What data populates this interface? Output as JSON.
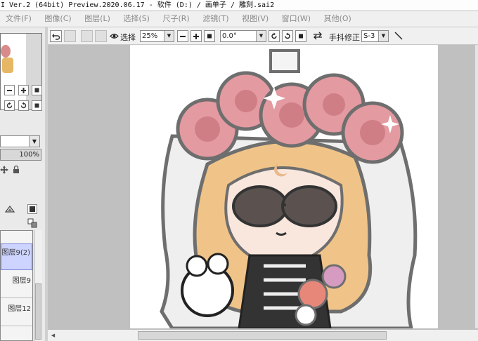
{
  "window": {
    "title": "I Ver.2 (64bit) Preview.2020.06.17 - 软件 (D:) / 画单子 / 雕刻.sai2"
  },
  "menu": [
    {
      "label": "文件(F)"
    },
    {
      "label": "图像(C)"
    },
    {
      "label": "图层(L)"
    },
    {
      "label": "选择(S)"
    },
    {
      "label": "尺子(R)"
    },
    {
      "label": "滤镜(T)"
    },
    {
      "label": "视图(V)"
    },
    {
      "label": "窗口(W)"
    },
    {
      "label": "其他(O)"
    }
  ],
  "toolbar": {
    "selection_label": "选择",
    "zoom_value": "25%",
    "rotation_value": "0.0°",
    "stabilizer_label": "手抖修正",
    "stabilizer_value": "S-3"
  },
  "left_panel": {
    "opacity_value": "100%",
    "layers": [
      {
        "name": "图层9(2)"
      },
      {
        "name": "图层9"
      },
      {
        "name": "图层12"
      }
    ]
  },
  "colors": {
    "canvas": "#ffffff",
    "workspace": "#c0c0c0",
    "selected_layer": "#cdd4ff",
    "flower": "#e39aa0",
    "hair": "#f0c488"
  }
}
